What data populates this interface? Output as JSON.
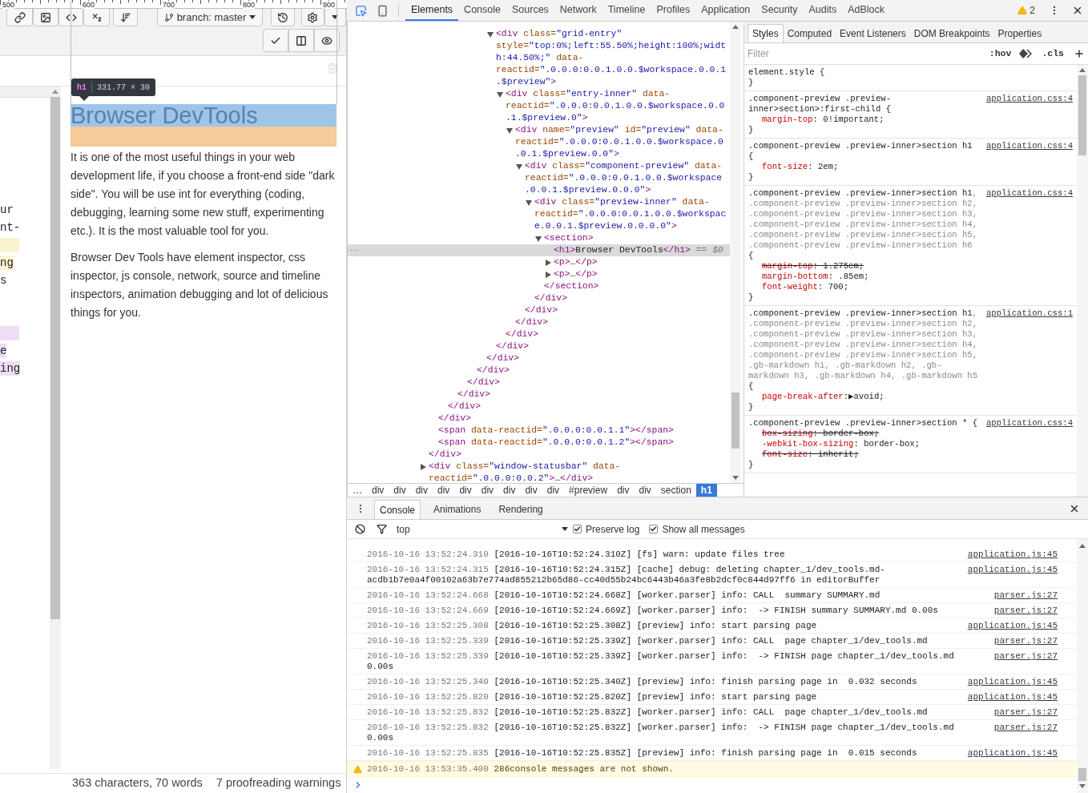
{
  "editor": {
    "ruler_labels": [
      "500",
      "600",
      "700",
      "800",
      "900"
    ],
    "toolbar": [
      {
        "kind": "link"
      },
      {
        "kind": "image"
      },
      {
        "kind": "code"
      },
      {
        "kind": "subscript"
      },
      {
        "kind": "sort"
      },
      {
        "kind": "branch",
        "label": "branch: master"
      },
      {
        "kind": "history"
      },
      {
        "kind": "settings"
      },
      {
        "kind": "caret"
      }
    ],
    "toolbar_row2": [
      {
        "kind": "check"
      },
      {
        "kind": "columns"
      },
      {
        "kind": "eye"
      }
    ],
    "source_lines": [
      {
        "kind": "blank"
      },
      {
        "kind": "text",
        "text": "ur"
      },
      {
        "kind": "text",
        "text": "nt-"
      },
      {
        "kind": "mark",
        "color": "#fbf3d0"
      },
      {
        "kind": "text",
        "text": "ng",
        "color": "#fbf3d0"
      },
      {
        "kind": "text",
        "text": "s"
      },
      {
        "kind": "blank"
      },
      {
        "kind": "blank"
      },
      {
        "kind": "mark",
        "color": "#f0dcf5"
      },
      {
        "kind": "text",
        "text": "e",
        "color": "#f0dcf5"
      },
      {
        "kind": "text",
        "text": "ing",
        "color": "#f0dcf5"
      }
    ],
    "inspect_tooltip": {
      "tag": "h1",
      "size": "331.77 × 30"
    },
    "preview": {
      "heading": "Browser DevTools",
      "paragraphs": [
        "It is one of the most useful things in your web development life, if you choose a front-end side \"dark side\". You will be use int for everything (coding, debugging, learning some new stuff, experimenting etc.). It is the most valuable tool for you.",
        "Browser Dev Tools have element inspector, css inspector, js console, network, source and timeline inspectors, animation debugging and lot of delicious things for you."
      ]
    },
    "status_bar": [
      "363 characters, 70 words",
      "7 proofreading warnings"
    ]
  },
  "devtools": {
    "tabs": [
      {
        "label": "Elements",
        "selected": true
      },
      {
        "label": "Console",
        "selected": false
      },
      {
        "label": "Sources",
        "selected": false
      },
      {
        "label": "Network",
        "selected": false
      },
      {
        "label": "Timeline",
        "selected": false
      },
      {
        "label": "Profiles",
        "selected": false
      },
      {
        "label": "Application",
        "selected": false
      },
      {
        "label": "Security",
        "selected": false
      },
      {
        "label": "Audits",
        "selected": false
      },
      {
        "label": "AdBlock",
        "selected": false
      }
    ],
    "warning_count": "2",
    "dom_tree": [
      {
        "close": "</div>",
        "children": [
          {
            "close": "</div>",
            "children": [
              {
                "close": "</div>",
                "children": [
                  {
                    "close": "</div>",
                    "children": [
                      {
                        "close": "</div>",
                        "children": [
                          {
                            "close": "</div>",
                            "children": [
                              {
                                "close": "</div>",
                                "children": [
                                  {
                                    "expanded": true,
                                    "parts": [
                                      {
                                        "kind": "tag",
                                        "text": "<div"
                                      },
                                      {
                                        "kind": "attr",
                                        "text": " class="
                                      },
                                      {
                                        "kind": "value",
                                        "text": "\"grid-entry\""
                                      },
                                      {
                                        "kind": "attr",
                                        "text": " style="
                                      },
                                      {
                                        "kind": "value",
                                        "text": "\"top:0%;left:55.50%;height:100%;width:44.50%;\""
                                      },
                                      {
                                        "kind": "attr",
                                        "text": " data-reactid="
                                      },
                                      {
                                        "kind": "value",
                                        "text": "\".0.0.0:0.0.1.0.0.$workspace.0.0.1.$preview\""
                                      },
                                      {
                                        "kind": "tag",
                                        "text": ">"
                                      }
                                    ],
                                    "close": "</div>",
                                    "children": [
                                      {
                                        "expanded": true,
                                        "parts": [
                                          {
                                            "kind": "tag",
                                            "text": "<div"
                                          },
                                          {
                                            "kind": "attr",
                                            "text": " class="
                                          },
                                          {
                                            "kind": "value",
                                            "text": "\"entry-inner\""
                                          },
                                          {
                                            "kind": "attr",
                                            "text": " data-reactid="
                                          },
                                          {
                                            "kind": "value",
                                            "text": "\".0.0.0:0.0.1.0.0.$workspace.0.0.1.$preview.0\""
                                          },
                                          {
                                            "kind": "tag",
                                            "text": ">"
                                          }
                                        ],
                                        "close": "</div>",
                                        "children": [
                                          {
                                            "expanded": true,
                                            "parts": [
                                              {
                                                "kind": "tag",
                                                "text": "<div"
                                              },
                                              {
                                                "kind": "attr",
                                                "text": " name="
                                              },
                                              {
                                                "kind": "value",
                                                "text": "\"preview\""
                                              },
                                              {
                                                "kind": "attr",
                                                "text": " id="
                                              },
                                              {
                                                "kind": "value",
                                                "text": "\"preview\""
                                              },
                                              {
                                                "kind": "attr",
                                                "text": " data-reactid="
                                              },
                                              {
                                                "kind": "value",
                                                "text": "\".0.0.0:0.0.1.0.0.$workspace.0.0.1.$preview.0.0\""
                                              },
                                              {
                                                "kind": "tag",
                                                "text": ">"
                                              }
                                            ],
                                            "close": "</div>",
                                            "children": [
                                              {
                                                "expanded": true,
                                                "parts": [
                                                  {
                                                    "kind": "tag",
                                                    "text": "<div"
                                                  },
                                                  {
                                                    "kind": "attr",
                                                    "text": " class="
                                                  },
                                                  {
                                                    "kind": "value",
                                                    "text": "\"component-preview\""
                                                  },
                                                  {
                                                    "kind": "attr",
                                                    "text": " data-reactid="
                                                  },
                                                  {
                                                    "kind": "value",
                                                    "text": "\".0.0.0:0.0.1.0.0.$workspace.0.0.1.$preview.0.0.0\""
                                                  },
                                                  {
                                                    "kind": "tag",
                                                    "text": ">"
                                                  }
                                                ],
                                                "close": "</div>",
                                                "children": [
                                                  {
                                                    "expanded": true,
                                                    "parts": [
                                                      {
                                                        "kind": "tag",
                                                        "text": "<div"
                                                      },
                                                      {
                                                        "kind": "attr",
                                                        "text": " class="
                                                      },
                                                      {
                                                        "kind": "value",
                                                        "text": "\"preview-inner\""
                                                      },
                                                      {
                                                        "kind": "attr",
                                                        "text": " data-reactid="
                                                      },
                                                      {
                                                        "kind": "value",
                                                        "text": "\".0.0.0:0.0.1.0.0.$workspace.0.0.1.$preview.0.0.0.0\""
                                                      },
                                                      {
                                                        "kind": "tag",
                                                        "text": ">"
                                                      }
                                                    ],
                                                    "close": "</div>",
                                                    "children": [
                                                      {
                                                        "expanded": true,
                                                        "parts": [
                                                          {
                                                            "kind": "tag",
                                                            "text": "<section>"
                                                          }
                                                        ],
                                                        "close": "</section>",
                                                        "children": [
                                                          {
                                                            "selected": true,
                                                            "parts": [
                                                              {
                                                                "kind": "tag",
                                                                "text": "<h1>"
                                                              },
                                                              {
                                                                "kind": "text",
                                                                "text": "Browser DevTools"
                                                              },
                                                              {
                                                                "kind": "tag",
                                                                "text": "</h1>"
                                                              },
                                                              {
                                                                "kind": "ref",
                                                                "text": " == $0"
                                                              }
                                                            ]
                                                          },
                                                          {
                                                            "expanded": false,
                                                            "selected": false,
                                                            "parts": [
                                                              {
                                                                "kind": "tag",
                                                                "text": "<p>"
                                                              },
                                                              {
                                                                "kind": "text",
                                                                "text": "…"
                                                              },
                                                              {
                                                                "kind": "tag",
                                                                "text": "</p>"
                                                              }
                                                            ]
                                                          },
                                                          {
                                                            "expanded": false,
                                                            "selected": false,
                                                            "parts": [
                                                              {
                                                                "kind": "tag",
                                                                "text": "<p>"
                                                              },
                                                              {
                                                                "kind": "text",
                                                                "text": "…"
                                                              },
                                                              {
                                                                "kind": "tag",
                                                                "text": "</p>"
                                                              }
                                                            ]
                                                          }
                                                        ]
                                                      }
                                                    ]
                                                  }
                                                ]
                                              }
                                            ]
                                          }
                                        ]
                                      }
                                    ]
                                  }
                                ]
                              }
                            ]
                          }
                        ]
                      }
                    ]
                  }
                ]
              }
            ]
          },
          {
            "parts": [
              {
                "kind": "tag",
                "text": "<span"
              },
              {
                "kind": "attr",
                "text": " data-reactid="
              },
              {
                "kind": "value",
                "text": "\".0.0.0:0.0.1.1\""
              },
              {
                "kind": "tag",
                "text": "></span>"
              }
            ]
          },
          {
            "parts": [
              {
                "kind": "tag",
                "text": "<span"
              },
              {
                "kind": "attr",
                "text": " data-reactid="
              },
              {
                "kind": "value",
                "text": "\".0.0.0:0.0.1.2\""
              },
              {
                "kind": "tag",
                "text": "></span>"
              }
            ]
          }
        ]
      },
      {
        "expanded": false,
        "parts": [
          {
            "kind": "tag",
            "text": "<div"
          },
          {
            "kind": "attr",
            "text": " class="
          },
          {
            "kind": "value",
            "text": "\"window-statusbar\""
          },
          {
            "kind": "attr",
            "text": " data-reactid="
          },
          {
            "kind": "value",
            "text": "\".0.0.0:0.0.2\""
          },
          {
            "kind": "tag",
            "text": ">"
          },
          {
            "kind": "text",
            "text": "…"
          },
          {
            "kind": "tag",
            "text": "</div>"
          }
        ]
      }
    ],
    "breadcrumbs": [
      {
        "label": "…",
        "selected": false
      },
      {
        "label": "div",
        "selected": false
      },
      {
        "label": "div",
        "selected": false
      },
      {
        "label": "div",
        "selected": false
      },
      {
        "label": "div",
        "selected": false
      },
      {
        "label": "div",
        "selected": false
      },
      {
        "label": "div",
        "selected": false
      },
      {
        "label": "div",
        "selected": false
      },
      {
        "label": "div",
        "selected": false
      },
      {
        "label": "div",
        "selected": false
      },
      {
        "label": "#preview",
        "selected": false
      },
      {
        "label": "div",
        "selected": false
      },
      {
        "label": "div",
        "selected": false
      },
      {
        "label": "section",
        "selected": false
      },
      {
        "label": "h1",
        "selected": true
      }
    ],
    "styles": {
      "tabs": [
        {
          "label": "Styles",
          "selected": true
        },
        {
          "label": "Computed",
          "selected": false
        },
        {
          "label": "Event Listeners",
          "selected": false
        },
        {
          "label": "DOM Breakpoints",
          "selected": false
        },
        {
          "label": "Properties",
          "selected": false
        }
      ],
      "filter_placeholder": "Filter",
      "hov": ":hov",
      "cls": ".cls",
      "rules": [
        {
          "selector": [
            {
              "text": "element.style {",
              "matched": true
            }
          ],
          "close": "}"
        },
        {
          "source": "application.css:4",
          "selector": [
            {
              "text": ".component-preview .preview-inner>section>:first-child {",
              "matched": true
            }
          ],
          "properties": [
            {
              "name": "margin-top",
              "value": ": 0!important;",
              "overridden": false
            }
          ],
          "close": "}"
        },
        {
          "source": "application.css:4",
          "selector": [
            {
              "text": ".component-preview .preview-inner>section h1 {",
              "matched": true
            }
          ],
          "properties": [
            {
              "name": "font-size",
              "value": ": 2em;",
              "overridden": false
            }
          ],
          "close": "}"
        },
        {
          "source": "application.css:4",
          "selector": [
            {
              "text": ".component-preview .preview-inner>section h1",
              "matched": true
            },
            {
              "text": ", .component-preview .preview-inner>section h2, .component-preview .preview-inner>section h3, .component-preview .preview-inner>section h4, .component-preview .preview-inner>section h5, .component-preview .preview-inner>section h6",
              "matched": false
            },
            {
              "text": " {",
              "matched": true
            }
          ],
          "properties": [
            {
              "name": "margin-top",
              "value": ": 1.275em;",
              "overridden": true
            },
            {
              "name": "margin-bottom",
              "value": ": .85em;",
              "overridden": false
            },
            {
              "name": "font-weight",
              "value": ": 700;",
              "overridden": false
            }
          ],
          "close": "}"
        },
        {
          "source": "application.css:1",
          "selector": [
            {
              "text": ".component-preview .preview-inner>section h1",
              "matched": true
            },
            {
              "text": ", .component-preview .preview-inner>section h2, .component-preview .preview-inner>section h3, .component-preview .preview-inner>section h4, .component-preview .preview-inner>section h5, .gb-markdown h1, .gb-markdown h2, .gb-markdown h3, .gb-markdown h4, .gb-markdown h5",
              "matched": false
            },
            {
              "text": " {",
              "matched": true
            }
          ],
          "properties": [
            {
              "name": "page-break-after",
              "value": ":▶avoid;",
              "overridden": false
            }
          ],
          "close": "}"
        },
        {
          "source": "application.css:4",
          "selector": [
            {
              "text": ".component-preview .preview-inner>section * {",
              "matched": true
            }
          ],
          "properties": [
            {
              "name": "box-sizing",
              "value": ": border-box;",
              "overridden": true
            },
            {
              "name": "-webkit-box-sizing",
              "value": ": border-box;",
              "overridden": false
            },
            {
              "name": "font-size",
              "value": ": inherit;",
              "overridden": true
            }
          ],
          "close": "}"
        }
      ]
    },
    "drawer": {
      "tabs": [
        {
          "label": "Console",
          "selected": true
        },
        {
          "label": "Animations",
          "selected": false
        },
        {
          "label": "Rendering",
          "selected": false
        }
      ],
      "context": "top",
      "options": [
        {
          "label": "Preserve log",
          "checked": true
        },
        {
          "label": "Show all messages",
          "checked": true
        }
      ],
      "messages": [
        {
          "kind": "log",
          "time": "2016-10-16 13:52:24.310",
          "text": "[2016-10-16T10:52:24.310Z] [fs] warn: update files tree",
          "source": "application.js:45"
        },
        {
          "kind": "log",
          "time": "2016-10-16 13:52:24.315",
          "text": "[2016-10-16T10:52:24.315Z] [cache] debug: deleting chapter_1/dev_tools.md-acdb1b7e0a4f00102a63b7e774ad855212b65d86-cc40d55b24bc6443b46a3fe8b2dcf0c844d97ff6 in editorBuffer",
          "source": "application.js:45"
        },
        {
          "kind": "log",
          "time": "2016-10-16 13:52:24.668",
          "text": "[2016-10-16T10:52:24.668Z] [worker.parser] info: CALL  summary SUMMARY.md",
          "source": "parser.js:27"
        },
        {
          "kind": "log",
          "time": "2016-10-16 13:52:24.669",
          "text": "[2016-10-16T10:52:24.669Z] [worker.parser] info:  -> FINISH summary SUMMARY.md 0.00s",
          "source": "parser.js:27"
        },
        {
          "kind": "log",
          "time": "2016-10-16 13:52:25.308",
          "text": "[2016-10-16T10:52:25.308Z] [preview] info: start parsing page",
          "source": "application.js:45"
        },
        {
          "kind": "log",
          "time": "2016-10-16 13:52:25.339",
          "text": "[2016-10-16T10:52:25.339Z] [worker.parser] info: CALL  page chapter_1/dev_tools.md",
          "source": "parser.js:27"
        },
        {
          "kind": "log",
          "time": "2016-10-16 13:52:25.339",
          "text": "[2016-10-16T10:52:25.339Z] [worker.parser] info:  -> FINISH page chapter_1/dev_tools.md 0.00s",
          "source": "parser.js:27"
        },
        {
          "kind": "log",
          "time": "2016-10-16 13:52:25.340",
          "text": "[2016-10-16T10:52:25.340Z] [preview] info: finish parsing page in  0.032 seconds",
          "source": "application.js:45"
        },
        {
          "kind": "log",
          "time": "2016-10-16 13:52:25.820",
          "text": "[2016-10-16T10:52:25.820Z] [preview] info: start parsing page",
          "source": "application.js:45"
        },
        {
          "kind": "log",
          "time": "2016-10-16 13:52:25.832",
          "text": "[2016-10-16T10:52:25.832Z] [worker.parser] info: CALL  page chapter_1/dev_tools.md",
          "source": "parser.js:27"
        },
        {
          "kind": "log",
          "time": "2016-10-16 13:52:25.832",
          "text": "[2016-10-16T10:52:25.832Z] [worker.parser] info:  -> FINISH page chapter_1/dev_tools.md 0.00s",
          "source": "parser.js:27"
        },
        {
          "kind": "log",
          "time": "2016-10-16 13:52:25.835",
          "text": "[2016-10-16T10:52:25.835Z] [preview] info: finish parsing page in  0.015 seconds",
          "source": "application.js:45"
        },
        {
          "kind": "warning",
          "time": "2016-10-16 13:53:35.400",
          "text": "286console messages are not shown."
        }
      ]
    }
  }
}
